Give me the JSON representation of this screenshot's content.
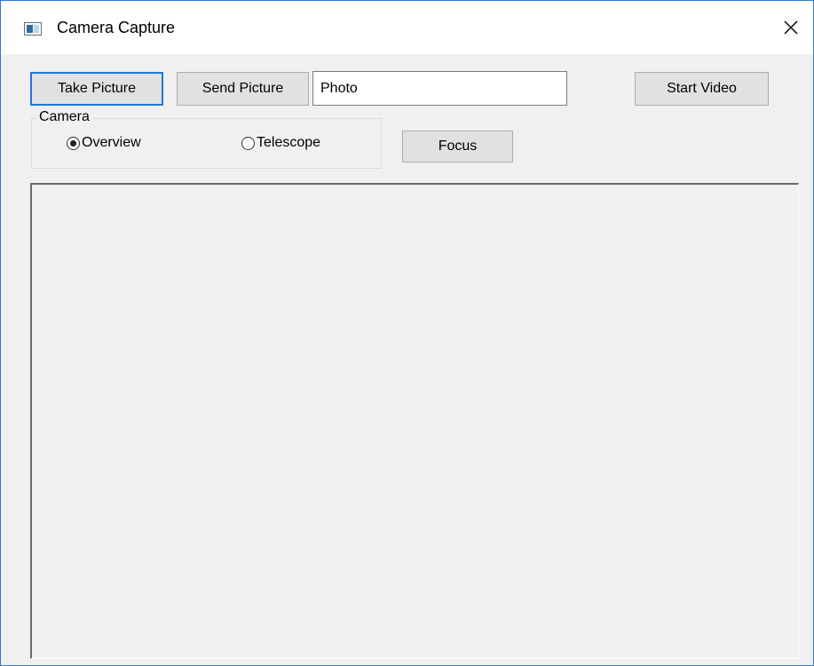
{
  "window": {
    "title": "Camera Capture",
    "accent_color": "#2b79d8",
    "app_icon": "window-app-icon",
    "close_icon": "close-icon"
  },
  "toolbar": {
    "take_picture_label": "Take Picture",
    "send_picture_label": "Send Picture",
    "photo_name_value": "Photo",
    "start_video_label": "Start Video"
  },
  "camera_group": {
    "label": "Camera",
    "options": [
      {
        "label": "Overview",
        "selected": true
      },
      {
        "label": "Telescope",
        "selected": false
      }
    ]
  },
  "focus_label": "Focus"
}
